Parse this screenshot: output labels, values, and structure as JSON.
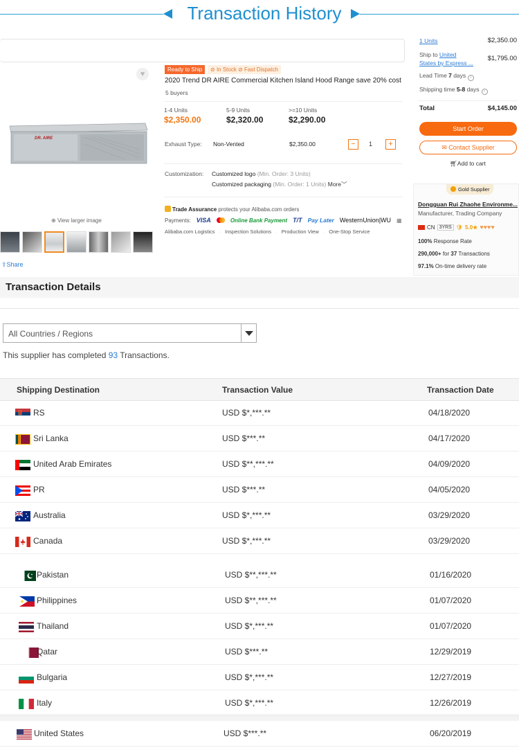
{
  "header": {
    "title": "Transaction History"
  },
  "product": {
    "badge_ready": "Ready to Ship",
    "badge_stock": "In Stock",
    "badge_dispatch": "Fast Dispatch",
    "title": "2020 Trend DR AIRE Commercial Kitchen Island Hood Range save 20% cost",
    "buyers": "5 buyers",
    "image_brand": "DR. AIRE",
    "view_larger": "View larger image",
    "share": "Share",
    "tiers": [
      {
        "qty": "1-4 Units",
        "price": "$2,350.00"
      },
      {
        "qty": "5-9 Units",
        "price": "$2,320.00"
      },
      {
        "qty": ">=10 Units",
        "price": "$2,290.00"
      }
    ],
    "exhaust_label": "Exhaust Type:",
    "exhaust_value": "Non-Vented",
    "exhaust_price": "$2,350.00",
    "quantity": "1",
    "minus": "−",
    "plus": "+",
    "customization_label": "Customization:",
    "custom_logo": "Customized logo",
    "custom_logo_min": "(Min. Order: 3 Units)",
    "custom_packaging": "Customized packaging",
    "custom_packaging_min": "(Min. Order: 1 Units)",
    "more": "More",
    "trade_assurance": "Trade Assurance",
    "trade_assurance_desc": "protects your Alibaba.com orders",
    "payments_label": "Payments:",
    "pay_visa": "VISA",
    "pay_obp": "Online Bank Payment",
    "pay_tt": "T/T",
    "pay_later": "Pay Later",
    "pay_wu": "WesternUnion|WU",
    "links": [
      "Alibaba.com Logistics",
      "Inspection Solutions",
      "Production View",
      "One-Stop Service"
    ]
  },
  "summary": {
    "units": "1 Units",
    "units_price": "$2,350.00",
    "ship_to_prefix": "Ship to",
    "ship_to_link": "United",
    "ship_to_link2": "States by Express ...",
    "ship_price": "$1,795.00",
    "lead_time_label": "Lead Time",
    "lead_time_value": "7",
    "lead_time_unit": "days",
    "shipping_time_label": "Shipping time",
    "shipping_time_value": "5-8",
    "shipping_time_unit": "days",
    "total_label": "Total",
    "total_value": "$4,145.00",
    "start_order": "Start Order",
    "contact_supplier": "Contact Supplier",
    "add_to_cart": "Add to cart"
  },
  "supplier": {
    "badge": "Gold Supplier",
    "name": "Dongguan Rui Zhaohe Environme...",
    "type": "Manufacturer, Trading Company",
    "country": "CN",
    "years": "3YRS",
    "rating": "5.0",
    "hearts": "♥♥♥♥",
    "response_rate_value": "100%",
    "response_rate_label": "Response Rate",
    "transactions_value": "290,000+",
    "transactions_mid": "for",
    "transactions_count": "37",
    "transactions_label": "Transactions",
    "ontime_value": "97.1%",
    "ontime_label": "On-time delivery rate"
  },
  "details": {
    "title": "Transaction Details",
    "filter_value": "All Countries / Regions",
    "completed_prefix": "This supplier has completed",
    "completed_count": "93",
    "completed_suffix": "Transactions.",
    "columns": [
      "Shipping Destination",
      "Transaction Value",
      "Transaction Date"
    ],
    "rows": [
      {
        "country": "RS",
        "value": "USD $*,***.**",
        "date": "04/18/2020",
        "flag": "rs"
      },
      {
        "country": "Sri Lanka",
        "value": "USD $***.**",
        "date": "04/17/2020",
        "flag": "lk"
      },
      {
        "country": "United Arab Emirates",
        "value": "USD $**,***.**",
        "date": "04/09/2020",
        "flag": "ae"
      },
      {
        "country": "PR",
        "value": "USD $***.**",
        "date": "04/05/2020",
        "flag": "pr"
      },
      {
        "country": "Australia",
        "value": "USD $*,***.**",
        "date": "03/29/2020",
        "flag": "au"
      },
      {
        "country": "Canada",
        "value": "USD $*,***.**",
        "date": "03/29/2020",
        "flag": "ca"
      },
      {
        "country": "Pakistan",
        "value": "USD $**,***.**",
        "date": "01/16/2020",
        "flag": "pk"
      },
      {
        "country": "Philippines",
        "value": "USD $**,***.**",
        "date": "01/07/2020",
        "flag": "ph"
      },
      {
        "country": "Thailand",
        "value": "USD $*,***.**",
        "date": "01/07/2020",
        "flag": "th"
      },
      {
        "country": "Qatar",
        "value": "USD $***.**",
        "date": "12/29/2019",
        "flag": "qa"
      },
      {
        "country": "Bulgaria",
        "value": "USD $*,***.**",
        "date": "12/27/2019",
        "flag": "bg"
      },
      {
        "country": "Italy",
        "value": "USD $*,***.**",
        "date": "12/26/2019",
        "flag": "it"
      },
      {
        "country": "United States",
        "value": "USD $***.**",
        "date": "06/20/2019",
        "flag": "us"
      }
    ]
  }
}
